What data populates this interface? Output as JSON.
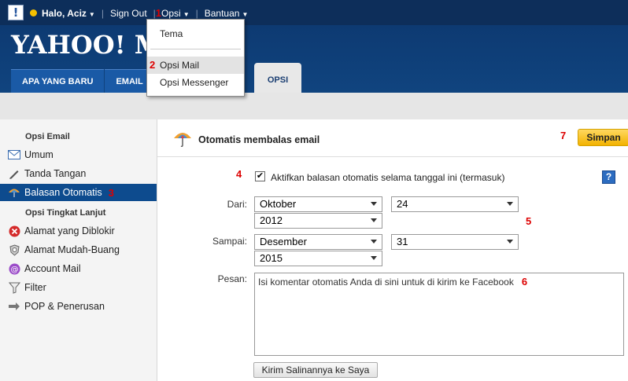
{
  "topbar": {
    "greeting": "Halo, Aciz",
    "sign_out": "Sign Out",
    "options": "Opsi",
    "help": "Bantuan",
    "badge_options": "1"
  },
  "header": {
    "logo": "YAHOO! MA",
    "tabs": [
      "APA YANG BARU",
      "EMAIL M"
    ],
    "active_tab": "OPSI"
  },
  "dropdown": {
    "items": [
      "Tema",
      "Opsi Mail",
      "Opsi Messenger"
    ],
    "badge": "2"
  },
  "sidebar": {
    "section1": "Opsi Email",
    "items1": [
      "Umum",
      "Tanda Tangan",
      "Balasan Otomatis"
    ],
    "section2": "Opsi Tingkat Lanjut",
    "items2": [
      "Alamat yang Diblokir",
      "Alamat Mudah-Buang",
      "Account Mail",
      "Filter",
      "POP & Penerusan"
    ],
    "badge": "3"
  },
  "main": {
    "title": "Otomatis membalas email",
    "save": "Simpan",
    "save_badge": "7",
    "checkbox_label": "Aktifkan balasan otomatis selama tanggal ini (termasuk)",
    "checkbox_badge": "4",
    "from_label": "Dari:",
    "from_month": "Oktober",
    "from_day": "24",
    "from_year": "2012",
    "date_badge": "5",
    "to_label": "Sampai:",
    "to_month": "Desember",
    "to_day": "31",
    "to_year": "2015",
    "message_label": "Pesan:",
    "message": "Isi komentar otomatis Anda di sini untuk di kirim ke Facebook",
    "message_badge": "6",
    "send_copy": "Kirim Salinannya ke Saya"
  },
  "colors": {
    "topbar": "#0d2e5a",
    "header": "#10447f",
    "tab": "#1a5aa6",
    "sidebar_active": "#0d4b8e",
    "save_button": "#f2b200",
    "badge": "#dd0000"
  }
}
